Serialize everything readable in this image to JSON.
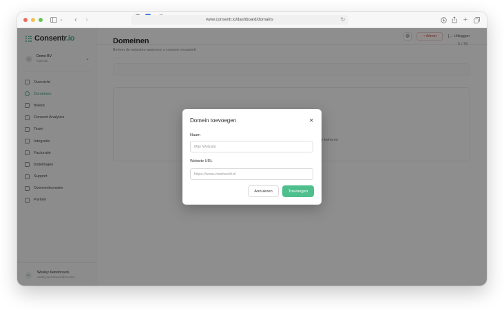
{
  "browser": {
    "url": "www.consentr.io/dashboard/domains",
    "icons": [
      "sidebar-toggle-icon",
      "back-icon",
      "forward-icon",
      "reload-icon",
      "download-icon",
      "share-icon",
      "new-tab-icon",
      "tabs-overview-icon"
    ]
  },
  "brand": {
    "name": "Consentr",
    "tld": ".io",
    "accent": "#3aa97c"
  },
  "org": {
    "avatar": "D",
    "name": "Demo BV",
    "role": "Eigenaar"
  },
  "sidebar": {
    "items": [
      {
        "label": "Overzicht",
        "icon": "grid-icon",
        "active": false
      },
      {
        "label": "Domeinen",
        "icon": "globe-icon",
        "active": true
      },
      {
        "label": "Beleid",
        "icon": "document-icon",
        "active": false
      },
      {
        "label": "Consent Analytics",
        "icon": "chart-icon",
        "active": false
      },
      {
        "label": "Team",
        "icon": "users-icon",
        "active": false
      },
      {
        "label": "Integratie",
        "icon": "code-icon",
        "active": false
      },
      {
        "label": "Facturatie",
        "icon": "credit-card-icon",
        "active": false
      },
      {
        "label": "Instellingen",
        "icon": "gear-icon",
        "active": false
      },
      {
        "label": "Support",
        "icon": "support-icon",
        "active": false
      },
      {
        "label": "Overeenkomsten",
        "icon": "contract-icon",
        "active": false
      },
      {
        "label": "Partner",
        "icon": "partner-icon",
        "active": false
      }
    ]
  },
  "user": {
    "avatar": "W",
    "name": "Wesley Kerrebrouck",
    "email": "wesley.kerrebrouck@consen..."
  },
  "topbar": {
    "admin_label": "Admin",
    "logout_label": "Uitloggen"
  },
  "main": {
    "title": "Domeinen",
    "subtitle": "Beheer de websites waarvoor u consent verzamelt",
    "count": "0 / 50",
    "empty_text": "te beheren"
  },
  "modal": {
    "title": "Domein toevoegen",
    "name_label": "Naam",
    "name_placeholder": "Mijn Website",
    "url_label": "Website URL",
    "url_placeholder": "https://www.voorbeeld.nl",
    "cancel_label": "Annuleren",
    "submit_label": "Toevoegen",
    "submit_color": "#4fc08d"
  }
}
